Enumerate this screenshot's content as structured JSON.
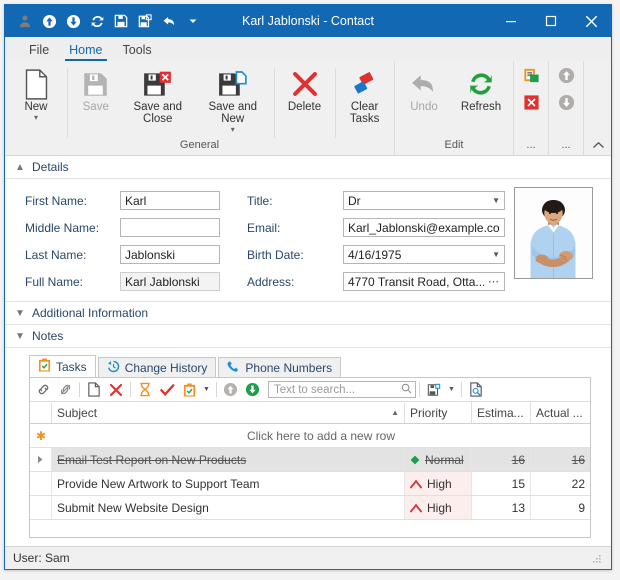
{
  "window": {
    "title": "Karl Jablonski - Contact",
    "accent": "#1268b3",
    "minimize": "minimize-button",
    "maximize": "maximize-button",
    "close": "close-button"
  },
  "quick_access": [
    {
      "name": "contact-icon",
      "label": "Contact"
    },
    {
      "name": "previous-record-icon",
      "label": "Previous Record"
    },
    {
      "name": "next-record-icon",
      "label": "Next Record"
    },
    {
      "name": "refresh-icon",
      "label": "Refresh"
    },
    {
      "name": "save-icon",
      "label": "Save"
    },
    {
      "name": "save-and-close-icon",
      "label": "Save and Close"
    },
    {
      "name": "undo-icon",
      "label": "Undo"
    },
    {
      "name": "customize-qat-icon",
      "label": "Customize Quick Access Toolbar"
    }
  ],
  "ribbon": {
    "tabs": [
      {
        "label": "File",
        "active": false
      },
      {
        "label": "Home",
        "active": true
      },
      {
        "label": "Tools",
        "active": false
      }
    ],
    "groups": [
      {
        "label": "General",
        "buttons": [
          {
            "label": "New",
            "icon": "new-document-icon",
            "dropdown": true,
            "disabled": false
          },
          {
            "label": "Save",
            "icon": "save-icon",
            "dropdown": false,
            "disabled": true
          },
          {
            "label": "Save and Close",
            "icon": "save-and-close-icon",
            "dropdown": false,
            "disabled": false
          },
          {
            "label": "Save and New",
            "icon": "save-and-new-icon",
            "dropdown": true,
            "disabled": false
          },
          {
            "label": "Delete",
            "icon": "delete-icon",
            "dropdown": false,
            "disabled": false
          },
          {
            "label": "Clear Tasks",
            "icon": "clear-tasks-icon",
            "dropdown": false,
            "disabled": false
          }
        ]
      },
      {
        "label": "Edit",
        "buttons": [
          {
            "label": "Undo",
            "icon": "undo-icon",
            "dropdown": false,
            "disabled": true
          },
          {
            "label": "Refresh",
            "icon": "refresh-icon",
            "dropdown": false,
            "disabled": false
          }
        ]
      },
      {
        "label": "...",
        "buttons": [
          {
            "label": "",
            "icon": "paste-icon",
            "dropdown": false,
            "disabled": false
          },
          {
            "label": "",
            "icon": "cancel-icon",
            "dropdown": false,
            "disabled": false
          }
        ]
      },
      {
        "label": "...",
        "buttons": [
          {
            "label": "",
            "icon": "move-up-icon",
            "dropdown": false,
            "disabled": true
          },
          {
            "label": "",
            "icon": "move-down-icon",
            "dropdown": false,
            "disabled": true
          }
        ]
      }
    ],
    "collapse_label": "Collapse the Ribbon"
  },
  "sections": {
    "details": {
      "title": "Details",
      "expanded": true
    },
    "additional": {
      "title": "Additional Information",
      "expanded": false
    },
    "notes": {
      "title": "Notes",
      "expanded": false
    }
  },
  "details": {
    "left_fields": [
      {
        "label": "First Name:",
        "value": "Karl",
        "kind": "text",
        "readonly": false,
        "placeholder": ""
      },
      {
        "label": "Middle Name:",
        "value": "",
        "kind": "text",
        "readonly": false,
        "placeholder": ""
      },
      {
        "label": "Last Name:",
        "value": "Jablonski",
        "kind": "text",
        "readonly": false,
        "placeholder": ""
      },
      {
        "label": "Full Name:",
        "value": "Karl Jablonski",
        "kind": "text",
        "readonly": true,
        "placeholder": ""
      }
    ],
    "right_fields": [
      {
        "label": "Title:",
        "value": "Dr",
        "kind": "combo",
        "readonly": false,
        "placeholder": ""
      },
      {
        "label": "Email:",
        "value": "Karl_Jablonski@example.com",
        "kind": "text",
        "readonly": false,
        "placeholder": ""
      },
      {
        "label": "Birth Date:",
        "value": "4/16/1975",
        "kind": "combo",
        "readonly": false,
        "placeholder": ""
      },
      {
        "label": "Address:",
        "value": "4770 Transit Road, Otta...",
        "kind": "ellipsis",
        "readonly": false,
        "placeholder": ""
      }
    ],
    "photo_alt": "contact-photo"
  },
  "doc_tabs": [
    {
      "label": "Tasks",
      "icon": "tasks-icon",
      "active": true
    },
    {
      "label": "Change History",
      "icon": "history-icon",
      "active": false
    },
    {
      "label": "Phone Numbers",
      "icon": "phone-icon",
      "active": false
    }
  ],
  "grid_toolbar": {
    "buttons": [
      {
        "name": "link-icon",
        "label": "Link"
      },
      {
        "name": "unlink-icon",
        "label": "Unlink"
      },
      {
        "name": "new-task-icon",
        "label": "New Task"
      },
      {
        "name": "delete-task-icon",
        "label": "Delete Task"
      },
      {
        "name": "deferred-icon",
        "label": "Deferred"
      },
      {
        "name": "complete-icon",
        "label": "Complete"
      },
      {
        "name": "status-icon",
        "label": "Status"
      },
      {
        "name": "move-up-icon",
        "label": "Move Up"
      },
      {
        "name": "move-down-icon",
        "label": "Move Down"
      }
    ],
    "search": {
      "placeholder": "Text to search...",
      "value": "",
      "icon": "search-icon"
    },
    "right_buttons": [
      {
        "name": "layout-icon",
        "label": "Layout"
      },
      {
        "name": "print-preview-icon",
        "label": "Print Preview"
      }
    ]
  },
  "grid": {
    "columns": [
      {
        "key": "indicator",
        "label": ""
      },
      {
        "key": "subject",
        "label": "Subject",
        "sorted": "asc"
      },
      {
        "key": "priority",
        "label": "Priority"
      },
      {
        "key": "estimated",
        "label": "Estima..."
      },
      {
        "key": "actual",
        "label": "Actual ..."
      }
    ],
    "new_row_text": "Click here to add a new row",
    "rows": [
      {
        "subject": "Email Test Report on New Products",
        "priority": "Normal",
        "priority_icon": "normal-priority-icon",
        "estimated": "16",
        "actual": "16",
        "completed": true,
        "selected": true
      },
      {
        "subject": "Provide New Artwork to Support Team",
        "priority": "High",
        "priority_icon": "high-priority-icon",
        "estimated": "15",
        "actual": "22",
        "completed": false,
        "selected": false
      },
      {
        "subject": "Submit New Website Design",
        "priority": "High",
        "priority_icon": "high-priority-icon",
        "estimated": "13",
        "actual": "9",
        "completed": false,
        "selected": false
      }
    ]
  },
  "statusbar": {
    "text": "User: Sam",
    "grip": "resize-grip"
  },
  "colors": {
    "accent": "#1268b3",
    "ribbon_bg": "#f0f0f0",
    "high_priority": "#d64040",
    "normal_priority": "#1e9e4a",
    "label_blue": "#29476b"
  }
}
